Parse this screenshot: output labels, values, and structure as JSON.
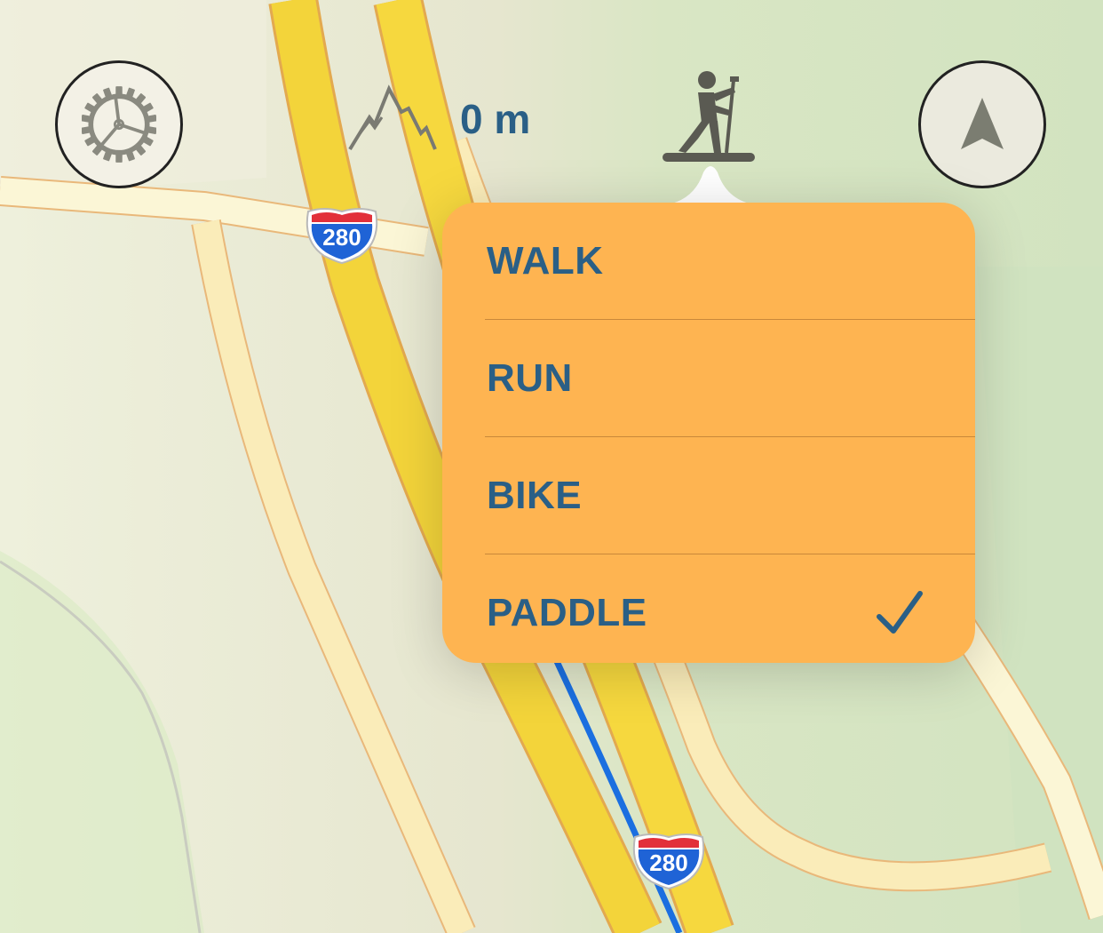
{
  "toolbar": {
    "settings_icon": "gear-icon",
    "elevation_icon": "mountain-icon",
    "elevation_value": "0 m",
    "activity_icon": "paddleboard-icon",
    "locate_icon": "location-arrow-icon"
  },
  "map": {
    "shields": [
      {
        "label": "280"
      },
      {
        "label": "280"
      }
    ]
  },
  "activity_menu": {
    "items": [
      {
        "label": "WALK",
        "selected": false
      },
      {
        "label": "RUN",
        "selected": false
      },
      {
        "label": "BIKE",
        "selected": false
      },
      {
        "label": "PADDLE",
        "selected": true
      }
    ],
    "check_icon": "checkmark-icon"
  },
  "colors": {
    "menu_background": "#feb451",
    "menu_text": "#2a5f86",
    "highway": "#f6d63b",
    "route": "#1b6fe0",
    "land": "#dfe8c9"
  }
}
